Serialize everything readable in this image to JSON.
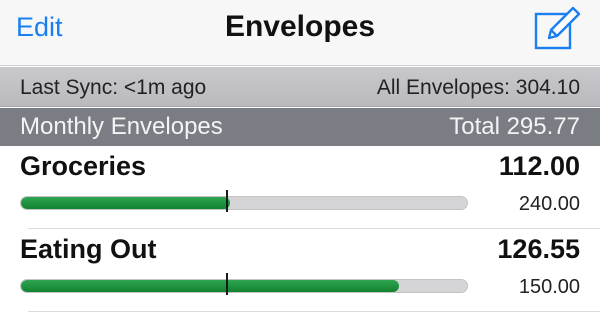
{
  "navbar": {
    "edit_label": "Edit",
    "title": "Envelopes",
    "compose_icon": "compose-icon",
    "accent_color": "#1a7ff0"
  },
  "sync_bar": {
    "last_sync": "Last Sync: <1m ago",
    "all_envelopes": "All Envelopes: 304.10"
  },
  "section": {
    "title": "Monthly Envelopes",
    "total": "Total 295.77"
  },
  "envelopes": [
    {
      "name": "Groceries",
      "amount": "112.00",
      "budget": "240.00",
      "fill_fraction": 0.467,
      "marker_fraction": 0.46
    },
    {
      "name": "Eating Out",
      "amount": "126.55",
      "budget": "150.00",
      "fill_fraction": 0.844,
      "marker_fraction": 0.46
    }
  ],
  "colors": {
    "bar_fill": "#1e9a43",
    "bar_track": "#d5d5d8",
    "section_header": "#7a7d83"
  }
}
